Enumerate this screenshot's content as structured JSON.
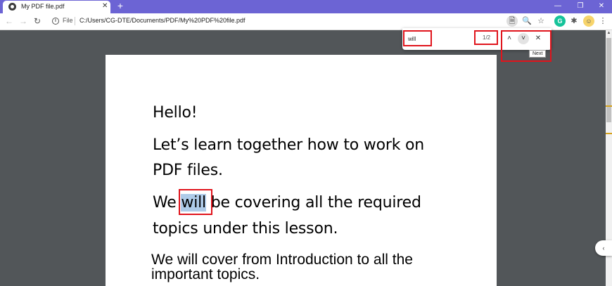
{
  "browser": {
    "tab_title": "My PDF file.pdf",
    "tab_close": "✕",
    "new_tab": "+",
    "window_controls": {
      "minimize": "—",
      "restore": "❐",
      "close": "✕"
    },
    "nav": {
      "back": "←",
      "forward": "→",
      "reload": "↻"
    },
    "address": {
      "scheme_label": "File",
      "url": "C:/Users/CG-DTE/Documents/PDF/My%20PDF%20file.pdf"
    },
    "toolbar_icons": {
      "pdf": "🗎",
      "zoom": "🔍",
      "bookmark": "☆",
      "grammarly": "G",
      "extensions": "✱",
      "profile": "☺",
      "menu": "⋮"
    }
  },
  "find_bar": {
    "query": "will",
    "match_count": "1/2",
    "prev": "˄",
    "next": "˅",
    "close": "✕",
    "tooltip": "Next"
  },
  "document": {
    "line1": "Hello!",
    "line2": "Let’s learn together how to work on",
    "line3": "PDF files.",
    "line4_pre": "We ",
    "line4_match": "will",
    "line4_post": " be covering all the required",
    "line5": "topics under this lesson.",
    "line6": "We will cover from Introduction to all the",
    "line7": "important topics."
  },
  "scrollbar": {
    "up_arrow": "▲"
  },
  "side_button": "‹"
}
